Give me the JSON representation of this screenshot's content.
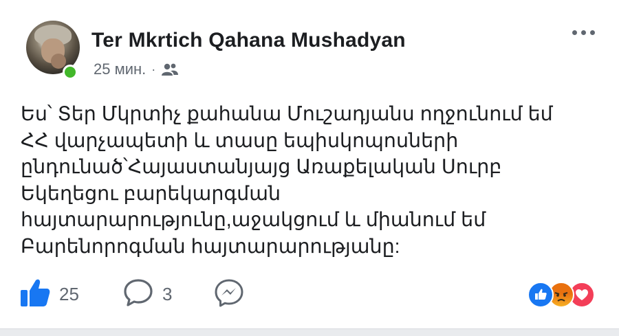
{
  "post": {
    "author": "Ter Mkrtich Qahana Mushadyan",
    "time": "25 мин.",
    "separator": "·",
    "audience_icon": "friends-icon",
    "text_lines": [
      "Ես՝ Տեր Մկրտիչ քահանա Մուշադյանս ողջունում եմ",
      "ՀՀ վարչապետի և տասը եպիսկոպոսների",
      "ընդունած՝Հայաստանյայց Առաքելական Սուրբ",
      "Եկեղեցու բարեկարգման",
      "հայտարարությունը,աջակցում և միանում եմ",
      "Բարենորոգման հայտարարությանը:"
    ]
  },
  "actions": {
    "like_icon": "thumbs-up-icon",
    "like_count": "25",
    "comment_icon": "comment-icon",
    "comment_count": "3",
    "share_icon": "messenger-icon"
  },
  "reactions": [
    "like-reaction-icon",
    "angry-reaction-icon",
    "love-reaction-icon"
  ],
  "colors": {
    "text": "#1c1e21",
    "secondary": "#606770",
    "like_blue": "#1877f2",
    "online_green": "#42b72a"
  }
}
